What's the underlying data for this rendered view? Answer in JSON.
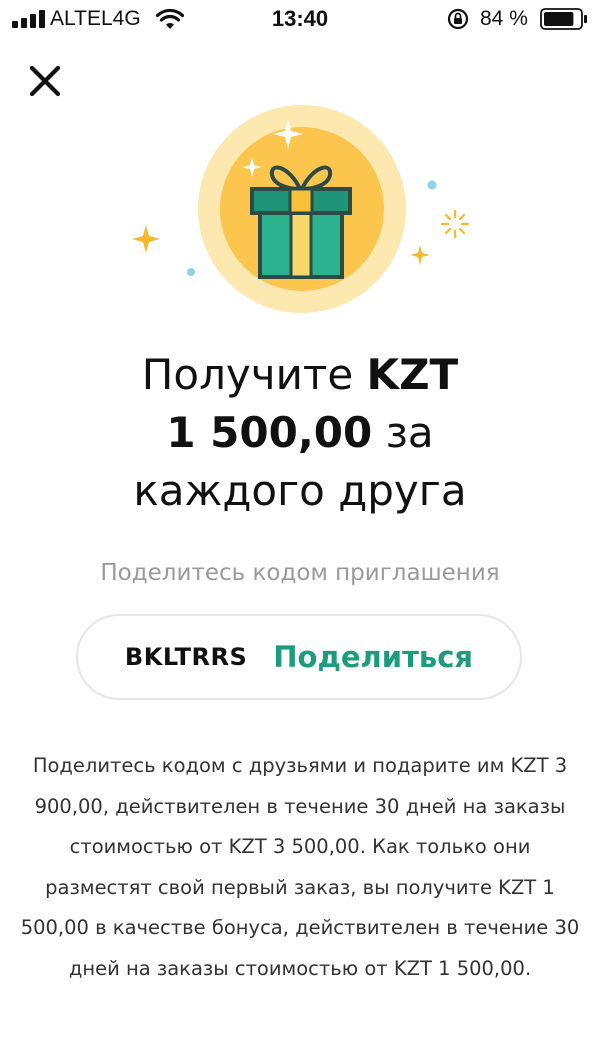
{
  "status_bar": {
    "carrier": "ALTEL4G",
    "time": "13:40",
    "battery_percent": "84 %",
    "battery_level": 0.84
  },
  "headline": {
    "line1_pre": "Получите ",
    "line1_bold": "KZT",
    "line2_bold": "1 500,00",
    "line2_post": " за",
    "line3": "каждого друга"
  },
  "share_label": "Поделитесь кодом приглашения",
  "invite": {
    "code": "BKLTRRS",
    "share_button": "Поделиться"
  },
  "description": "Поделитесь кодом с друзьями и подарите им KZT 3 900,00, действителен в течение 30 дней на заказы стоимостью от KZT 3 500,00. Как только они разместят свой первый заказ, вы получите KZT 1 500,00 в качестве бонуса, действителен в течение 30 дней на заказы стоимостью от KZT 1 500,00.",
  "colors": {
    "accent_green": "#1c9c7c",
    "gift_teal": "#2cb38e",
    "gift_yellow": "#f7c13a",
    "circle_outer": "#fde8b0",
    "circle_inner": "#fcc54e"
  },
  "icons": [
    "signal-icon",
    "wifi-icon",
    "rotation-lock-icon",
    "battery-icon",
    "close-icon",
    "gift-icon",
    "sparkle-icon"
  ]
}
